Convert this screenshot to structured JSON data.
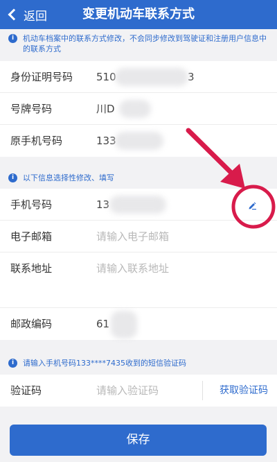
{
  "header": {
    "back_label": "返回",
    "title": "变更机动车联系方式"
  },
  "notice_top": "机动车档案中的联系方式修改，不会同步修改到驾驶证和注册用户信息中的联系方式",
  "fixed_info": {
    "id_label": "身份证明号码",
    "id_value_start": "510",
    "id_value_end": "3",
    "plate_label": "号牌号码",
    "plate_value": "川D",
    "orig_phone_label": "原手机号码",
    "orig_phone_value": "133"
  },
  "notice_optional": "以下信息选择性修改、填写",
  "editable": {
    "phone_label": "手机号码",
    "phone_value": "13",
    "email_label": "电子邮箱",
    "email_placeholder": "请输入电子邮箱",
    "address_label": "联系地址",
    "address_placeholder": "请输入联系地址",
    "postal_label": "邮政编码",
    "postal_value": "61"
  },
  "notice_sms": "请输入手机号码133****7435收到的短信验证码",
  "verify": {
    "label": "验证码",
    "placeholder": "请输入验证码",
    "get_code_label": "获取验证码"
  },
  "save_label": "保存",
  "colors": {
    "primary": "#2e6bcd",
    "annotation": "#d81b4b"
  }
}
